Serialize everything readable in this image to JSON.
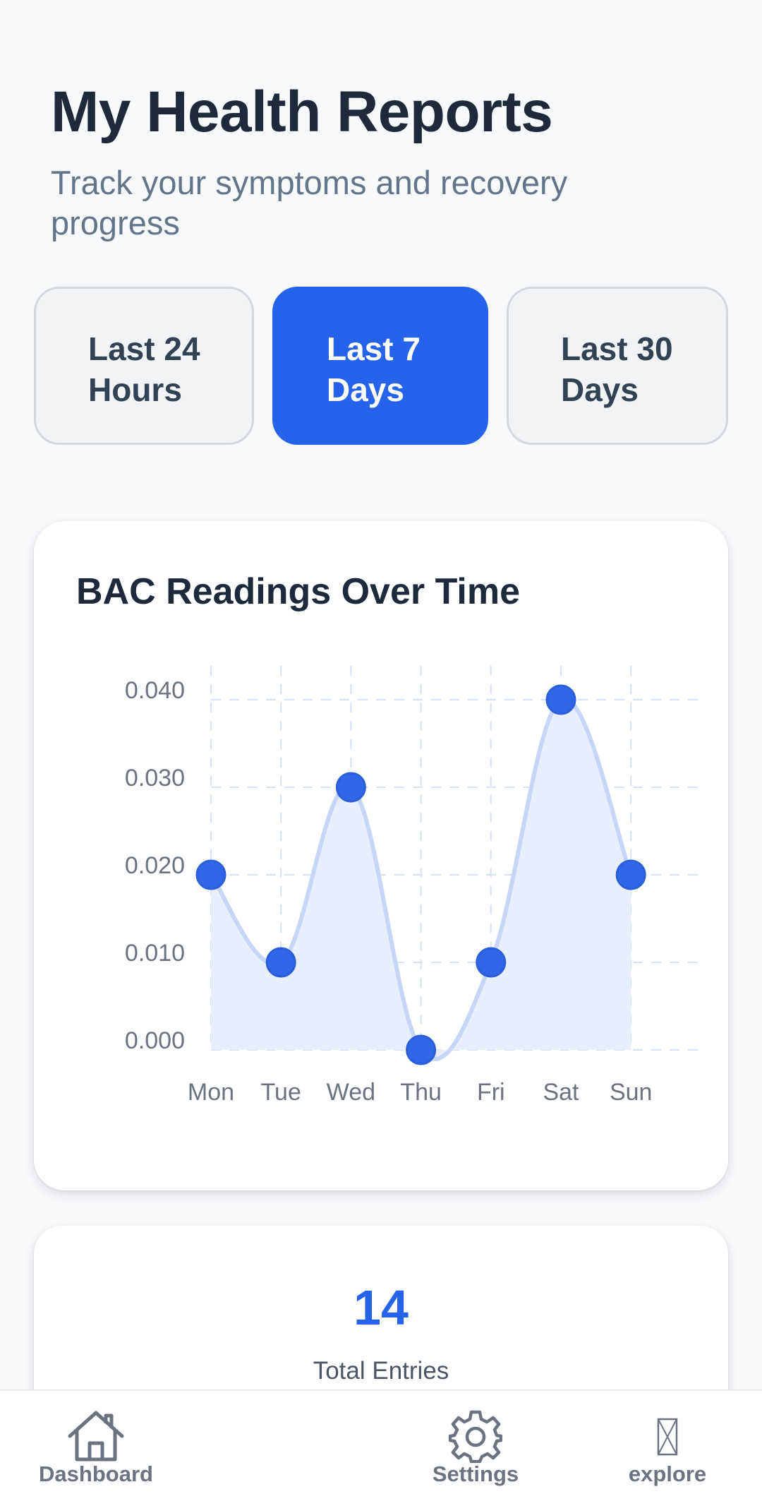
{
  "header": {
    "title": "My Health Reports",
    "subtitle": "Track your symptoms and recovery progress"
  },
  "range_tabs": [
    {
      "label": "Last 24 Hours",
      "active": false
    },
    {
      "label": "Last 7 Days",
      "active": true
    },
    {
      "label": "Last 30 Days",
      "active": false
    }
  ],
  "chart_card": {
    "title": "BAC Readings Over Time"
  },
  "chart_data": {
    "type": "line",
    "title": "BAC Readings Over Time",
    "categories": [
      "Mon",
      "Tue",
      "Wed",
      "Thu",
      "Fri",
      "Sat",
      "Sun"
    ],
    "values": [
      0.02,
      0.01,
      0.03,
      0.0,
      0.01,
      0.04,
      0.02
    ],
    "y_ticks": [
      "0.000",
      "0.010",
      "0.020",
      "0.030",
      "0.040"
    ],
    "ylim": [
      0,
      0.04
    ],
    "grid": true,
    "line_color": "#c7d6f7",
    "fill_color": "#e8eefc",
    "point_color": "#2f67e8"
  },
  "stats": {
    "value": "14",
    "label": "Total Entries"
  },
  "bottom_nav": [
    {
      "label": "Dashboard",
      "icon": "home-icon"
    },
    {
      "label": "Settings",
      "icon": "gear-icon"
    },
    {
      "label": "explore",
      "icon": "missing-glyph-icon"
    }
  ],
  "colors": {
    "accent": "#2563eb",
    "text_dark": "#1e293b",
    "text_muted": "#64748b"
  }
}
